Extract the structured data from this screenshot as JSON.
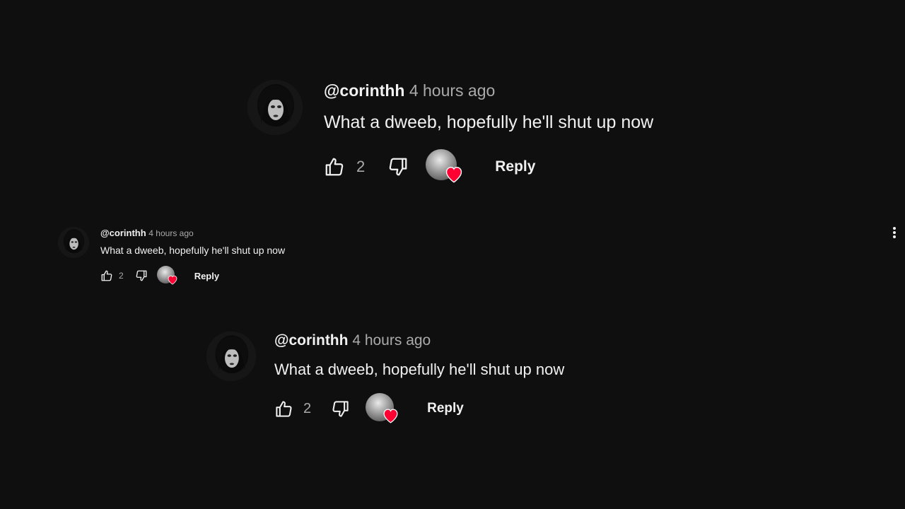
{
  "comments": [
    {
      "handle": "@corinthh",
      "time": "4 hours ago",
      "text": "What a dweeb, hopefully he'll shut up now",
      "likes": "2",
      "reply_label": "Reply",
      "avatar_icon": "user-avatar",
      "like_icon": "thumbs-up-icon",
      "dislike_icon": "thumbs-down-icon",
      "heart_icon": "creator-heart-icon"
    },
    {
      "handle": "@corinthh",
      "time": "4 hours ago",
      "text": "What a dweeb, hopefully he'll shut up now",
      "likes": "2",
      "reply_label": "Reply"
    },
    {
      "handle": "@corinthh",
      "time": "4 hours ago",
      "text": "What a dweeb, hopefully he'll shut up now",
      "likes": "2",
      "reply_label": "Reply"
    }
  ],
  "menu_icon": "more-vertical-icon",
  "colors": {
    "background": "#0f0f0f",
    "text": "#f1f1f1",
    "muted": "#aaaaaa",
    "heart": "#ff0033"
  }
}
